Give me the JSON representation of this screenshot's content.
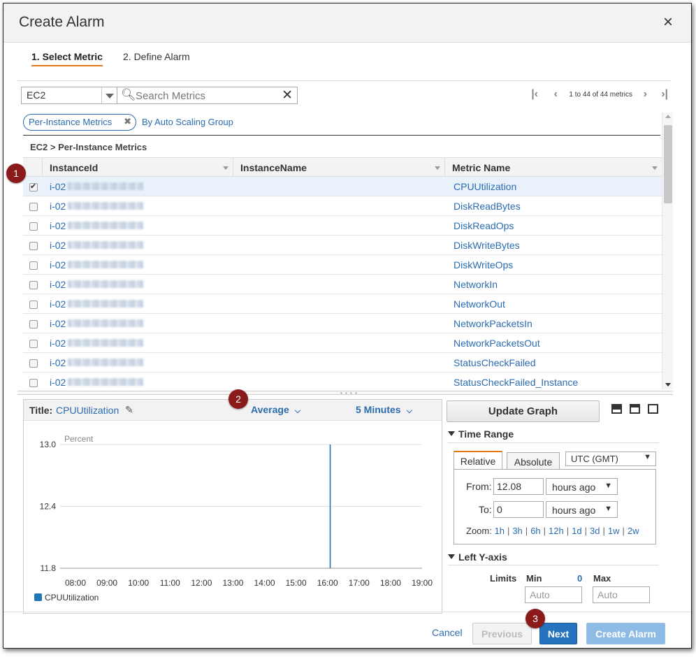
{
  "dialog": {
    "title": "Create Alarm",
    "close_icon": "×"
  },
  "steps": [
    {
      "label": "1. Select Metric",
      "active": true
    },
    {
      "label": "2. Define Alarm",
      "active": false
    }
  ],
  "toolbar": {
    "namespace": "EC2",
    "search_placeholder": "Search Metrics",
    "pagination": "1 to 44 of 44 metrics"
  },
  "filters": {
    "chip": "Per-Instance Metrics",
    "link": "By Auto Scaling Group"
  },
  "breadcrumb": "EC2 > Per-Instance Metrics",
  "table": {
    "columns": [
      "InstanceId",
      "InstanceName",
      "Metric Name"
    ],
    "rows": [
      {
        "instance": "i-02",
        "name": "",
        "metric": "CPUUtilization",
        "checked": true
      },
      {
        "instance": "i-02",
        "name": "",
        "metric": "DiskReadBytes",
        "checked": false
      },
      {
        "instance": "i-02",
        "name": "",
        "metric": "DiskReadOps",
        "checked": false
      },
      {
        "instance": "i-02",
        "name": "",
        "metric": "DiskWriteBytes",
        "checked": false
      },
      {
        "instance": "i-02",
        "name": "",
        "metric": "DiskWriteOps",
        "checked": false
      },
      {
        "instance": "i-02",
        "name": "",
        "metric": "NetworkIn",
        "checked": false
      },
      {
        "instance": "i-02",
        "name": "",
        "metric": "NetworkOut",
        "checked": false
      },
      {
        "instance": "i-02",
        "name": "",
        "metric": "NetworkPacketsIn",
        "checked": false
      },
      {
        "instance": "i-02",
        "name": "",
        "metric": "NetworkPacketsOut",
        "checked": false
      },
      {
        "instance": "i-02",
        "name": "",
        "metric": "StatusCheckFailed",
        "checked": false
      },
      {
        "instance": "i-02",
        "name": "",
        "metric": "StatusCheckFailed_Instance",
        "checked": false
      }
    ]
  },
  "graph": {
    "title_label": "Title:",
    "title": "CPUUtilization",
    "statistic": "Average",
    "period": "5 Minutes",
    "legend": "CPUUtilization"
  },
  "chart_data": {
    "type": "line",
    "title": "",
    "ylabel": "Percent",
    "xlabel": "",
    "x_ticks": [
      "08:00",
      "09:00",
      "10:00",
      "11:00",
      "12:00",
      "13:00",
      "14:00",
      "15:00",
      "16:00",
      "17:00",
      "18:00",
      "19:00"
    ],
    "y_ticks": [
      11.8,
      12.4,
      13.0
    ],
    "ylim": [
      11.8,
      13.0
    ],
    "grid": true,
    "series": [
      {
        "name": "CPUUtilization",
        "color": "#1f77b4",
        "points": [
          {
            "x": "16:05",
            "y": 11.8
          },
          {
            "x": "16:05",
            "y": 13.0
          }
        ]
      }
    ]
  },
  "right_panel": {
    "update_button": "Update Graph",
    "time_range_header": "Time Range",
    "tabs": [
      "Relative",
      "Absolute"
    ],
    "timezone": "UTC (GMT)",
    "from_label": "From:",
    "from_value": "12.08",
    "from_unit": "hours ago",
    "to_label": "To:",
    "to_value": "0",
    "to_unit": "hours ago",
    "zoom_label": "Zoom:",
    "zoom_options": [
      "1h",
      "3h",
      "6h",
      "12h",
      "1d",
      "3d",
      "1w",
      "2w"
    ],
    "left_y_header": "Left Y-axis",
    "limits_label": "Limits",
    "min_label": "Min",
    "min_hint": "0",
    "max_label": "Max",
    "min_placeholder": "Auto",
    "max_placeholder": "Auto"
  },
  "footer": {
    "cancel": "Cancel",
    "previous": "Previous",
    "next": "Next",
    "create": "Create Alarm"
  },
  "markers": [
    "1",
    "2",
    "3"
  ],
  "colors": {
    "accent_orange": "#e47911",
    "link_blue": "#2b6cb0",
    "primary_button": "#2773bd",
    "marker_red": "#8b1a1a"
  }
}
